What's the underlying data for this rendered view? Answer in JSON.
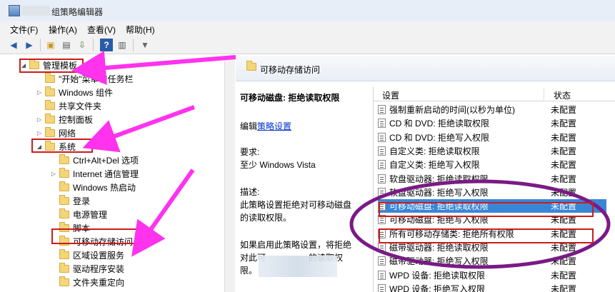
{
  "window": {
    "title": "组策略编辑器"
  },
  "menu": [
    "文件(F)",
    "操作(A)",
    "查看(V)",
    "帮助(H)"
  ],
  "toolbar_icons": [
    "back-icon",
    "forward-icon",
    "up-folder-icon",
    "show-tree-icon",
    "export-icon",
    "help-icon",
    "properties-icon",
    "filter-icon"
  ],
  "tree": [
    {
      "label": "管理模板",
      "level": 0,
      "expander": "◢"
    },
    {
      "label": "\"开始\"菜单和任务栏",
      "level": 1,
      "expander": ""
    },
    {
      "label": "Windows 组件",
      "level": 1,
      "expander": "▷"
    },
    {
      "label": "共享文件夹",
      "level": 1,
      "expander": ""
    },
    {
      "label": "控制面板",
      "level": 1,
      "expander": "▷"
    },
    {
      "label": "网络",
      "level": 1,
      "expander": "▷"
    },
    {
      "label": "系统",
      "level": 1,
      "expander": "◢"
    },
    {
      "label": "Ctrl+Alt+Del 选项",
      "level": 2,
      "expander": ""
    },
    {
      "label": "Internet 通信管理",
      "level": 2,
      "expander": "▷"
    },
    {
      "label": "Windows 热启动",
      "level": 2,
      "expander": ""
    },
    {
      "label": "登录",
      "level": 2,
      "expander": ""
    },
    {
      "label": "电源管理",
      "level": 2,
      "expander": ""
    },
    {
      "label": "脚本",
      "level": 2,
      "expander": ""
    },
    {
      "label": "可移动存储访问",
      "level": 2,
      "expander": ""
    },
    {
      "label": "区域设置服务",
      "level": 2,
      "expander": ""
    },
    {
      "label": "驱动程序安装",
      "level": 2,
      "expander": ""
    },
    {
      "label": "文件夹重定向",
      "level": 2,
      "expander": ""
    }
  ],
  "right_header": {
    "title": "可移动存储访问"
  },
  "description": {
    "title": "可移动磁盘: 拒绝读取权限",
    "edit_prefix": "编辑",
    "edit_link": "策略设置",
    "req_label": "要求:",
    "req_value": "至少 Windows Vista",
    "desc_label": "描述:",
    "desc_line1": "此策略设置拒绝对可移动磁盘",
    "desc_line2": "的读取权限。",
    "more_line1": "如果启用此策略设置，将拒绝",
    "more_line2": "对此可",
    "more_line2b": "的读取权",
    "more_line3": "限。"
  },
  "list": {
    "col_setting": "设置",
    "col_state": "状态",
    "rows": [
      {
        "name": "强制重新启动的时间(以秒为单位)",
        "state": "未配置"
      },
      {
        "name": "CD 和 DVD: 拒绝读取权限",
        "state": "未配置"
      },
      {
        "name": "CD 和 DVD: 拒绝写入权限",
        "state": "未配置"
      },
      {
        "name": "自定义类: 拒绝读取权限",
        "state": "未配置"
      },
      {
        "name": "自定义类: 拒绝写入权限",
        "state": "未配置"
      },
      {
        "name": "软盘驱动器: 拒绝读取权限",
        "state": "未配置"
      },
      {
        "name": "软盘驱动器: 拒绝写入权限",
        "state": "未配置"
      },
      {
        "name": "可移动磁盘: 拒绝读取权限",
        "state": "未配置"
      },
      {
        "name": "可移动磁盘: 拒绝写入权限",
        "state": "未配置"
      },
      {
        "name": "所有可移动存储类: 拒绝所有权限",
        "state": "未配置"
      },
      {
        "name": "磁带驱动器: 拒绝读取权限",
        "state": "未配置"
      },
      {
        "name": "磁带驱动器: 拒绝写入权限",
        "state": "未配置"
      },
      {
        "name": "WPD 设备: 拒绝读取权限",
        "state": "未配置"
      },
      {
        "name": "WPD 设备: 拒绝写入权限",
        "state": "未配置"
      }
    ]
  },
  "colors": {
    "annotation_red": "#cc1c1c",
    "annotation_magenta": "#ff33ee",
    "annotation_purple": "#7a1a86",
    "selection_blue": "#3a86d6"
  }
}
